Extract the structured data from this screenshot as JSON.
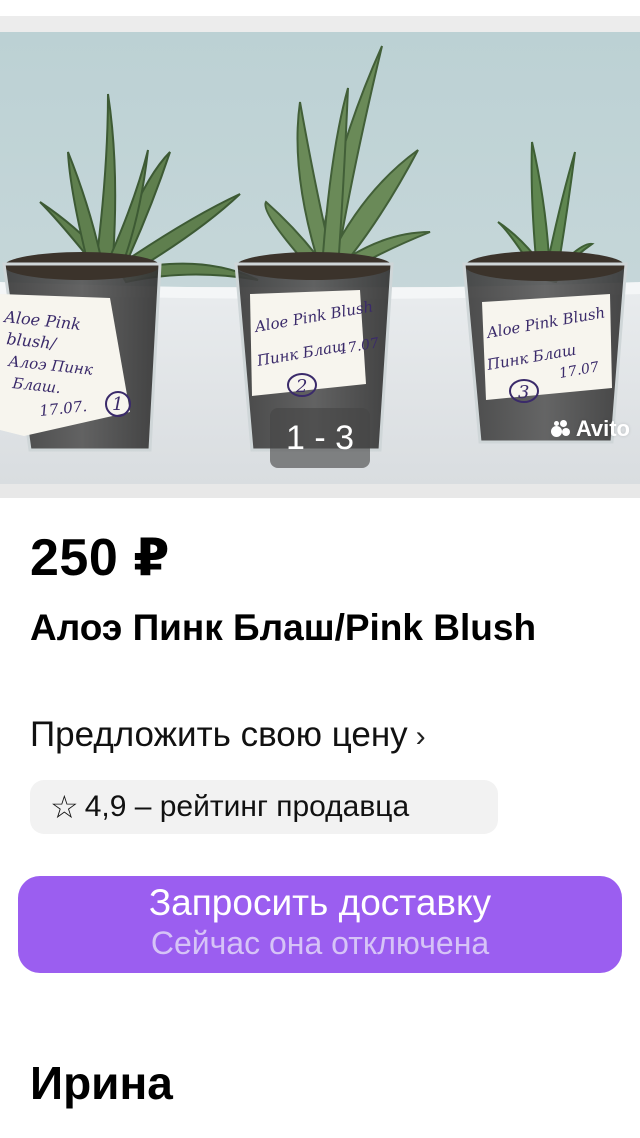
{
  "gallery": {
    "counter": "1 - 3",
    "watermark": "Avito",
    "labels": [
      [
        "Aloe Pink",
        "blush/",
        "Алоэ Пинк",
        "Блаш.",
        "17.07.",
        "1"
      ],
      [
        "Aloe Pink Blush",
        "Пинк Блаш",
        "17.07",
        "2"
      ],
      [
        "Aloe Pink Blush",
        "Пинк Блаш",
        "17.07",
        "3"
      ]
    ]
  },
  "listing": {
    "price": "250 ₽",
    "title": "Алоэ Пинк Блаш/Pink Blush",
    "offer_label": "Предложить свою цену",
    "offer_chevron": "›",
    "rating_star": "☆",
    "rating_text": "4,9 – рейтинг продавца"
  },
  "delivery": {
    "label": "Запросить доставку",
    "sub_label": "Сейчас она отключена",
    "color": "#9b5ef0"
  },
  "seller": {
    "name": "Ирина"
  }
}
